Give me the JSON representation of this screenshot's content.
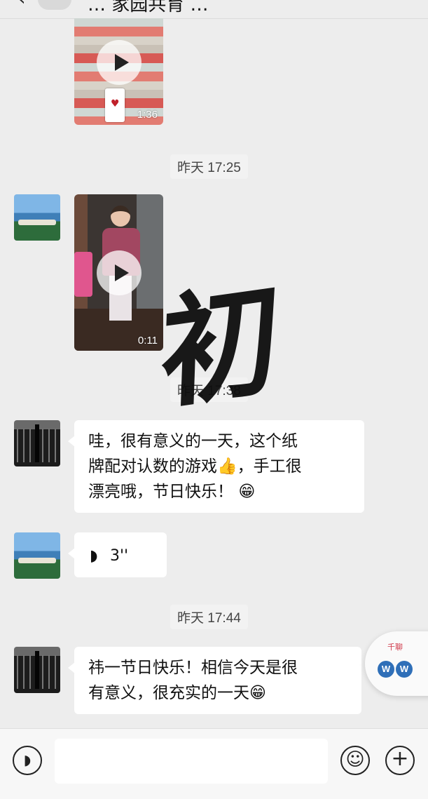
{
  "header": {
    "back_icon": "chevron-left-icon",
    "title": "… 家园共育 …"
  },
  "messages": {
    "video1": {
      "duration": "1:36"
    },
    "ts1": "昨天 17:25",
    "video2": {
      "duration": "0:11"
    },
    "ts2": "昨天 17:38",
    "text1": {
      "line1": "哇，很有意义的一天，这个纸",
      "line2a": "牌配对认数的游戏",
      "emoji_thumb": "👍",
      "line2b": "，手工很",
      "line3": "漂亮哦，节日快乐！",
      "emoji_grin": "😁"
    },
    "voice": {
      "duration": "3''"
    },
    "ts3": "昨天 17:44",
    "text2": {
      "line1": "祎一节日快乐！相信今天是很",
      "line2": "有意义，很充实的一天",
      "emoji_grin": "😁"
    }
  },
  "overlay": {
    "calligraphy_char": "初"
  },
  "floating_widget": {
    "caption": "千聊",
    "letter1": "W",
    "letter2": "W"
  },
  "inputbar": {
    "voice_icon": "voice-icon",
    "emoji_icon": "emoji-icon",
    "plus_icon": "plus-icon",
    "input_value": "",
    "input_placeholder": ""
  }
}
